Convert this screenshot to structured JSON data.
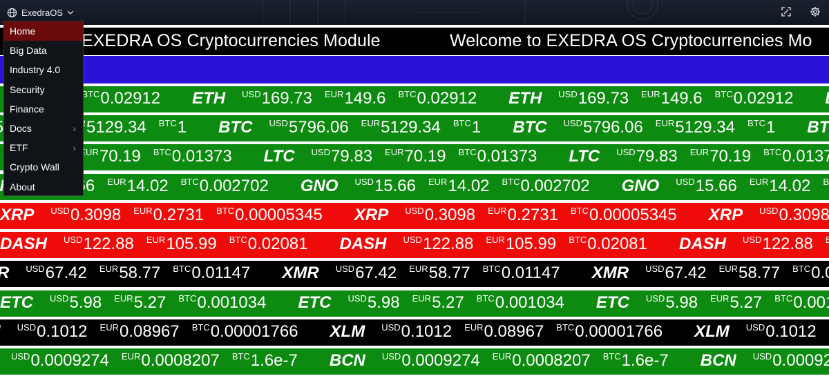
{
  "app": {
    "name": "ExedraOS",
    "icons": {
      "globe": "globe-icon",
      "dropdown": "chevron-down-icon",
      "fullscreen": "fullscreen-icon",
      "settings": "gear-icon"
    }
  },
  "menu": {
    "items": [
      {
        "label": "Home",
        "active": true,
        "submenu": false
      },
      {
        "label": "Big Data",
        "active": false,
        "submenu": false
      },
      {
        "label": "Industry 4.0",
        "active": false,
        "submenu": false
      },
      {
        "label": "Security",
        "active": false,
        "submenu": false
      },
      {
        "label": "Finance",
        "active": false,
        "submenu": false
      },
      {
        "label": "Docs",
        "active": false,
        "submenu": true
      },
      {
        "label": "ETF",
        "active": false,
        "submenu": true
      },
      {
        "label": "Crypto Wall",
        "active": false,
        "submenu": false
      },
      {
        "label": "About",
        "active": false,
        "submenu": false
      }
    ]
  },
  "banner": {
    "title_partial": "EXEDRA OS Cryptocurrencies Module",
    "welcome_partial": "Welcome to EXEDRA OS Cryptocurrencies Mo"
  },
  "colors": {
    "blue_band": "#2a12d6",
    "green": "#0d8a10",
    "red": "#f00b0b",
    "black": "#000000",
    "menu_active": "#6b0a0a"
  },
  "tickers": [
    {
      "symbol": "ETH",
      "usd": "169.73",
      "eur": "149.6",
      "btc": "0.02912",
      "color": "#0d8a10",
      "visible_symbol_head": "H"
    },
    {
      "symbol": "BTC",
      "usd": "5796.06",
      "eur": "5129.34",
      "btc": "1",
      "color": "#0d8a10"
    },
    {
      "symbol": "LTC",
      "usd": "79.83",
      "eur": "70.19",
      "btc": "0.01373",
      "color": "#0d8a10"
    },
    {
      "symbol": "GNO",
      "usd": "15.66",
      "eur": "14.02",
      "btc": "0.002702",
      "color": "#0d8a10",
      "visible_symbol_head": "NO"
    },
    {
      "symbol": "XRP",
      "usd": "0.3098",
      "eur": "0.2731",
      "btc": "0.00005345",
      "color": "#f00b0b"
    },
    {
      "symbol": "DASH",
      "usd": "122.88",
      "eur": "105.99",
      "btc": "0.02081",
      "color": "#f00b0b"
    },
    {
      "symbol": "XMR",
      "usd": "67.42",
      "eur": "58.77",
      "btc": "0.01147",
      "color": "#000000",
      "visible_eur_head": "8.77"
    },
    {
      "symbol": "ETC",
      "usd": "5.98",
      "eur": "5.27",
      "btc": "0.001034",
      "color": "#0d8a10"
    },
    {
      "symbol": "XLM",
      "usd": "0.1012",
      "eur": "0.08967",
      "btc": "0.00001766",
      "color": "#000000",
      "visible_eur_head": "967"
    },
    {
      "symbol": "BCN",
      "usd": "0.0009274",
      "eur": "0.0008207",
      "btc": "1.6e-7",
      "color": "#0d8a10",
      "visible_eur_head": "0008207"
    }
  ],
  "currency_labels": {
    "usd": "USD",
    "eur": "EUR",
    "btc": "BTC"
  }
}
